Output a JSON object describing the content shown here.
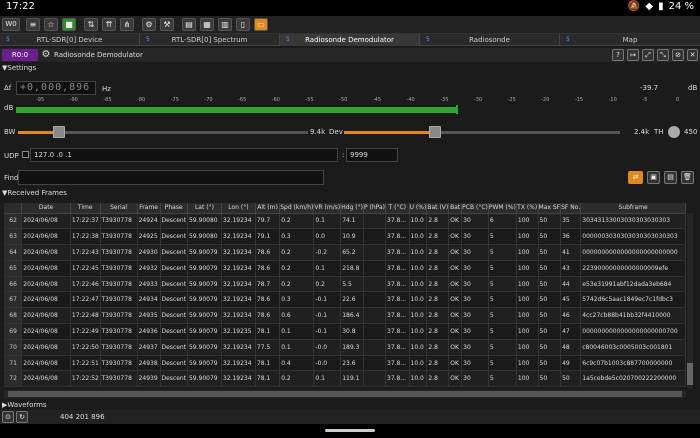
{
  "status": {
    "time": "17:22",
    "battery": "24 %"
  },
  "toolbar": {
    "workspace": "W0"
  },
  "tabs": [
    {
      "num": "5",
      "label": "RTL-SDR[0] Device"
    },
    {
      "num": "5",
      "label": "RTL-SDR[0] Spectrum"
    },
    {
      "num": "5",
      "label": "Radiosonde Demodulator"
    },
    {
      "num": "5",
      "label": "Radiosonde"
    },
    {
      "num": "5",
      "label": "Map"
    }
  ],
  "device": {
    "tag": "R0:0",
    "title": "Radiosonde Demodulator"
  },
  "settings": {
    "header": "Settings",
    "delta_f_label": "Δf",
    "freq": "+0,000,896",
    "hz": "Hz",
    "db_left": "dB",
    "power_value": "-39.7",
    "power_unit": "dB",
    "ticks": [
      "-95",
      "-90",
      "-85",
      "-80",
      "-75",
      "-70",
      "-65",
      "-60",
      "-55",
      "-50",
      "-45",
      "-40",
      "-35",
      "-30",
      "-25",
      "-20",
      "-15",
      "-10",
      "-5",
      "0"
    ]
  },
  "bw": {
    "label": "BW",
    "value": "9.4k",
    "fraction": 0.14
  },
  "dev": {
    "label": "Dev",
    "value": "2.4k",
    "fraction": 0.33
  },
  "th": {
    "label": "TH",
    "value": "450"
  },
  "udp": {
    "label": "UDP",
    "address": "127.0  .0  .1",
    "port": "9999"
  },
  "find": {
    "label": "Find",
    "value": ""
  },
  "frames": {
    "header": "Received Frames",
    "columns": [
      "Date",
      "Time",
      "Serial",
      "Frame",
      "Phase",
      "Lat (°)",
      "Lon (°)",
      "Alt (m)",
      "Spd (km/h)",
      "VR (m/s)",
      "Hdg (°)",
      "P (hPa)",
      "T (°C)",
      "U (%)",
      "Bat (V)",
      "Bat",
      "PCB (°C)",
      "PWM (%)",
      "TX (%)",
      "Max SF",
      "SF No.",
      "Subframe"
    ],
    "rows": [
      [
        "62",
        "2024/06/08",
        "17:22:37",
        "T3930778",
        "24924",
        "Descent",
        "59.90080",
        "32.19234",
        "79.7",
        "0.2",
        "0.1",
        "74.1",
        "",
        "37.8...",
        "10.0",
        "2.8",
        "OK",
        "30",
        "6",
        "100",
        "50",
        "35",
        "30343133003030303030303"
      ],
      [
        "63",
        "2024/06/08",
        "17:22:38",
        "T3930778",
        "24925",
        "Descent",
        "59.90080",
        "32.19234",
        "79.1",
        "0.3",
        "0.0",
        "10.9",
        "",
        "37.8...",
        "10.0",
        "2.8",
        "OK",
        "30",
        "5",
        "100",
        "50",
        "36",
        "0000003030303030303030303"
      ],
      [
        "64",
        "2024/06/08",
        "17:22:43",
        "T3930778",
        "24930",
        "Descent",
        "59.90079",
        "32.19234",
        "78.6",
        "0.2",
        "-0.2",
        "65.2",
        "",
        "37.8...",
        "10.0",
        "2.8",
        "OK",
        "30",
        "5",
        "100",
        "50",
        "41",
        "0000000000000000000000000"
      ],
      [
        "65",
        "2024/06/08",
        "17:22:45",
        "T3930778",
        "24932",
        "Descent",
        "59.90079",
        "32.19234",
        "78.6",
        "0.2",
        "0.1",
        "218.8",
        "",
        "37.8...",
        "10.0",
        "2.8",
        "OK",
        "30",
        "5",
        "100",
        "50",
        "43",
        "22390000000000000009efe"
      ],
      [
        "66",
        "2024/06/08",
        "17:22:46",
        "T3930778",
        "24933",
        "Descent",
        "59.90079",
        "32.19234",
        "78.7",
        "0.2",
        "0.2",
        "5.5",
        "",
        "37.8...",
        "10.0",
        "2.8",
        "OK",
        "30",
        "5",
        "100",
        "50",
        "44",
        "e53e31991abf12dada3eb684"
      ],
      [
        "67",
        "2024/06/08",
        "17:22:47",
        "T3930778",
        "24934",
        "Descent",
        "59.90079",
        "32.19234",
        "78.6",
        "0.3",
        "-0.1",
        "22.6",
        "",
        "37.8...",
        "10.0",
        "2.8",
        "OK",
        "30",
        "5",
        "100",
        "50",
        "45",
        "5742d6c5aac1849ec7c1fdbc3"
      ],
      [
        "68",
        "2024/06/08",
        "17:22:48",
        "T3930778",
        "24935",
        "Descent",
        "59.90079",
        "32.19234",
        "78.6",
        "0.6",
        "-0.1",
        "186.4",
        "",
        "37.8...",
        "10.0",
        "2.8",
        "OK",
        "30",
        "5",
        "100",
        "50",
        "46",
        "4cc27cb88b41bb32f4410000"
      ],
      [
        "69",
        "2024/06/08",
        "17:22:49",
        "T3930778",
        "24936",
        "Descent",
        "59.90079",
        "32.19235",
        "78.1",
        "0.1",
        "-0.1",
        "30.8",
        "",
        "37.8...",
        "10.0",
        "2.8",
        "OK",
        "30",
        "5",
        "100",
        "50",
        "47",
        "0000000000000000000000700"
      ],
      [
        "70",
        "2024/06/08",
        "17:22:50",
        "T3930778",
        "24937",
        "Descent",
        "59.90079",
        "32.19234",
        "77.5",
        "0.1",
        "-0.0",
        "189.3",
        "",
        "37.8...",
        "10.0",
        "2.8",
        "OK",
        "30",
        "5",
        "100",
        "50",
        "48",
        "c80046003c0005003c001801"
      ],
      [
        "71",
        "2024/06/08",
        "17:22:51",
        "T3930778",
        "24938",
        "Descent",
        "59.90079",
        "32.19234",
        "78.1",
        "0.4",
        "-0.0",
        "23.6",
        "",
        "37.8...",
        "10.0",
        "2.8",
        "OK",
        "30",
        "5",
        "100",
        "50",
        "49",
        "6c9c07b1003c887700000000"
      ],
      [
        "72",
        "2024/06/08",
        "17:22:52",
        "T3930778",
        "24939",
        "Descent",
        "59.90079",
        "32.19234",
        "78.1",
        "0.2",
        "0.1",
        "119.1",
        "",
        "37.8...",
        "10.0",
        "2.8",
        "OK",
        "30",
        "5",
        "100",
        "50",
        "50",
        "1a5cebde5c020700222200000"
      ]
    ]
  },
  "waveforms": {
    "header": "Waveforms"
  },
  "bottom": {
    "frequency": "404 201 896"
  }
}
